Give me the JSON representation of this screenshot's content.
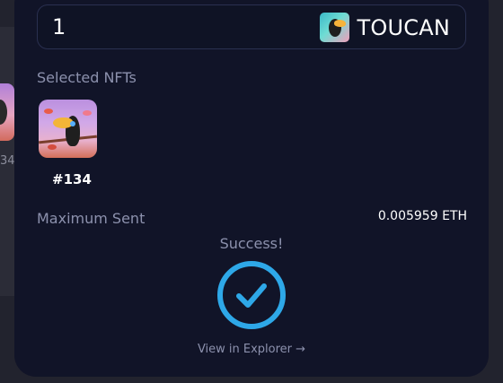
{
  "background": {
    "nft_label": "34"
  },
  "amount": {
    "value": "1",
    "token_symbol": "TOUCAN",
    "token_icon": "toucan-token-icon"
  },
  "selected_nfts": {
    "label": "Selected NFTs",
    "items": [
      {
        "id_label": "#134",
        "image": "toucan-nft-image"
      }
    ]
  },
  "maximum_sent": {
    "label": "Maximum Sent",
    "value": "0.005959 ETH"
  },
  "status": {
    "text": "Success!",
    "icon": "check-circle-icon",
    "explorer_link": "View in Explorer →"
  },
  "colors": {
    "modal_bg": "#111428",
    "accent": "#2ea8e8",
    "muted_text": "#8c91ad",
    "primary_text": "#ffffff"
  }
}
